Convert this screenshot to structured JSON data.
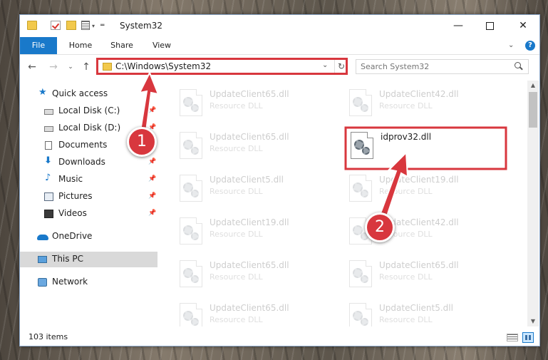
{
  "window": {
    "title": "System32",
    "minimize_glyph": "—",
    "close_glyph": "✕"
  },
  "ribbon": {
    "tabs": [
      "File",
      "Home",
      "Share",
      "View"
    ],
    "expand_glyph": "⌄",
    "help_glyph": "?"
  },
  "nav": {
    "back_glyph": "←",
    "forward_glyph": "→",
    "recent_glyph": "⌄",
    "up_glyph": "↑"
  },
  "address": {
    "path": "C:\\Windows\\System32",
    "dropdown_glyph": "⌄",
    "refresh_glyph": "↻"
  },
  "search": {
    "placeholder": "Search System32"
  },
  "sidebar": {
    "items": [
      {
        "label": "Quick access",
        "icon": "star-icon",
        "pinned": false
      },
      {
        "label": "Local Disk (C:)",
        "icon": "drive-icon",
        "pinned": true
      },
      {
        "label": "Local Disk (D:)",
        "icon": "drive-icon",
        "pinned": true
      },
      {
        "label": "Documents",
        "icon": "document-icon",
        "pinned": true
      },
      {
        "label": "Downloads",
        "icon": "download-icon",
        "pinned": true
      },
      {
        "label": "Music",
        "icon": "music-icon",
        "pinned": true
      },
      {
        "label": "Pictures",
        "icon": "picture-icon",
        "pinned": true
      },
      {
        "label": "Videos",
        "icon": "video-icon",
        "pinned": true
      },
      {
        "label": "OneDrive",
        "icon": "cloud-icon",
        "pinned": false
      },
      {
        "label": "This PC",
        "icon": "computer-icon",
        "pinned": false
      },
      {
        "label": "Network",
        "icon": "network-icon",
        "pinned": false
      }
    ],
    "pin_glyph": "📌",
    "star_glyph": "★",
    "down_glyph": "⬇",
    "music_glyph": "♪"
  },
  "files": {
    "type_label": "Resource DLL",
    "items": [
      {
        "name": "UpdateClient65.dll",
        "type": "Resource DLL"
      },
      {
        "name": "UpdateClient42.dll",
        "type": "Resource DLL"
      },
      {
        "name": "UpdateClient65.dll",
        "type": "Resource DLL"
      },
      {
        "name": "idprov32.dll",
        "type": ""
      },
      {
        "name": "UpdateClient5.dll",
        "type": "Resource DLL"
      },
      {
        "name": "UpdateClient19.dll",
        "type": "Resource DLL"
      },
      {
        "name": "UpdateClient19.dll",
        "type": "Resource DLL"
      },
      {
        "name": "UpdateClient42.dll",
        "type": "Resource DLL"
      },
      {
        "name": "UpdateClient65.dll",
        "type": "Resource DLL"
      },
      {
        "name": "UpdateClient65.dll",
        "type": "Resource DLL"
      },
      {
        "name": "UpdateClient65.dll",
        "type": "Resource DLL"
      },
      {
        "name": "UpdateClient5.dll",
        "type": "Resource DLL"
      }
    ]
  },
  "scrollbar": {
    "up_glyph": "▲",
    "down_glyph": "▼"
  },
  "status": {
    "item_count": "103 items"
  },
  "annotations": {
    "step1": "1",
    "step2": "2",
    "color": "#d8373e"
  },
  "colors": {
    "accent": "#1979ca",
    "annotation_red": "#d8373e",
    "selection": "#cce8ff"
  }
}
